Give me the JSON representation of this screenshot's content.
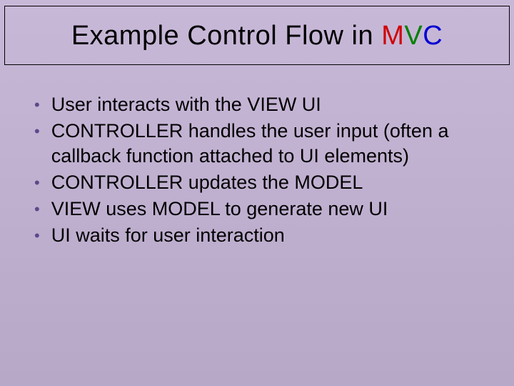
{
  "title": {
    "prefix": "Example Control Flow in ",
    "m": "M",
    "v": "V",
    "c": "C"
  },
  "bullets": [
    "User interacts with the VIEW UI",
    "CONTROLLER handles the user input (often a callback function attached to UI elements)",
    "CONTROLLER updates the MODEL",
    "VIEW uses MODEL to generate new UI",
    "UI waits for user interaction"
  ]
}
